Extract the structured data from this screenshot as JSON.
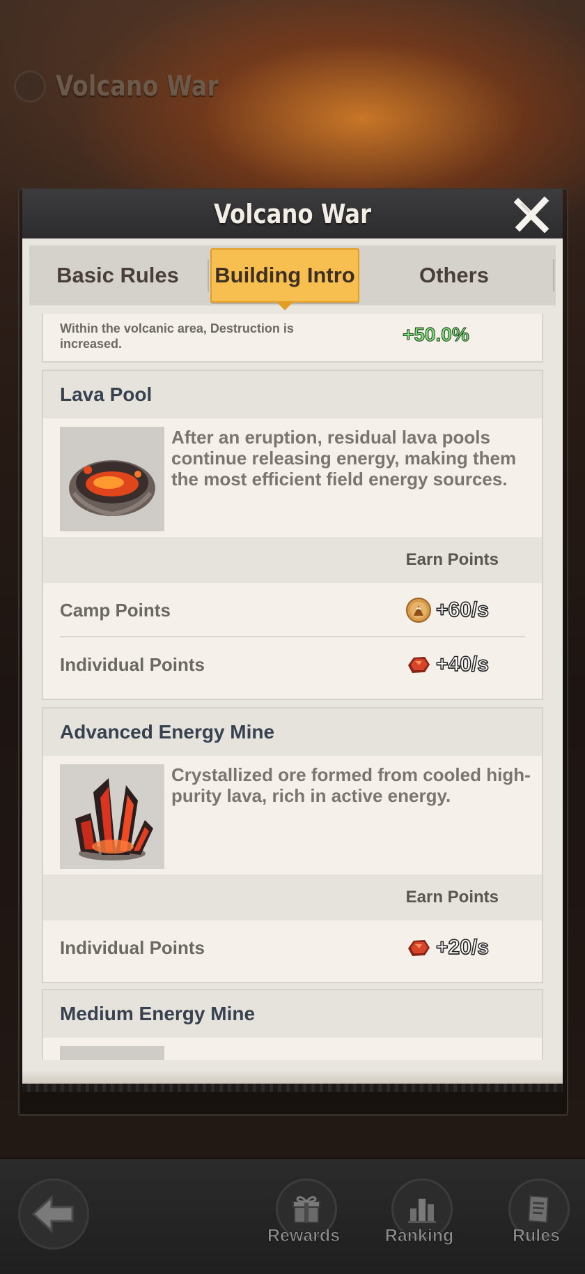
{
  "background": {
    "title": "Volcano War"
  },
  "modal": {
    "title": "Volcano War",
    "tabs": [
      {
        "label": "Basic Rules"
      },
      {
        "label": "Building Intro"
      },
      {
        "label": "Others"
      }
    ],
    "active_tab": "Building Intro"
  },
  "top_card": {
    "text": "Within the volcanic area, Destruction is increased.",
    "value": "+50.0%"
  },
  "buildings": [
    {
      "name": "Lava Pool",
      "description": "After an eruption, residual lava pools continue releasing energy, making them the most efficient field energy sources.",
      "earn_header": "Earn Points",
      "rows": [
        {
          "label": "Camp Points",
          "icon": "camp-coin-icon",
          "value": "+60/s"
        },
        {
          "label": "Individual Points",
          "icon": "ore-icon",
          "value": "+40/s"
        }
      ]
    },
    {
      "name": "Advanced Energy Mine",
      "description": "Crystallized ore formed from cooled high-purity lava, rich in active energy.",
      "earn_header": "Earn Points",
      "rows": [
        {
          "label": "Individual Points",
          "icon": "ore-icon",
          "value": "+20/s"
        }
      ]
    },
    {
      "name": "Medium Energy Mine"
    }
  ],
  "bottom_nav": {
    "rewards": "Rewards",
    "ranking": "Ranking",
    "rules": "Rules"
  },
  "colors": {
    "tab_active": "#f6bf4f",
    "positive_value": "#7de07a",
    "header_dark": "#2c2c2e"
  }
}
